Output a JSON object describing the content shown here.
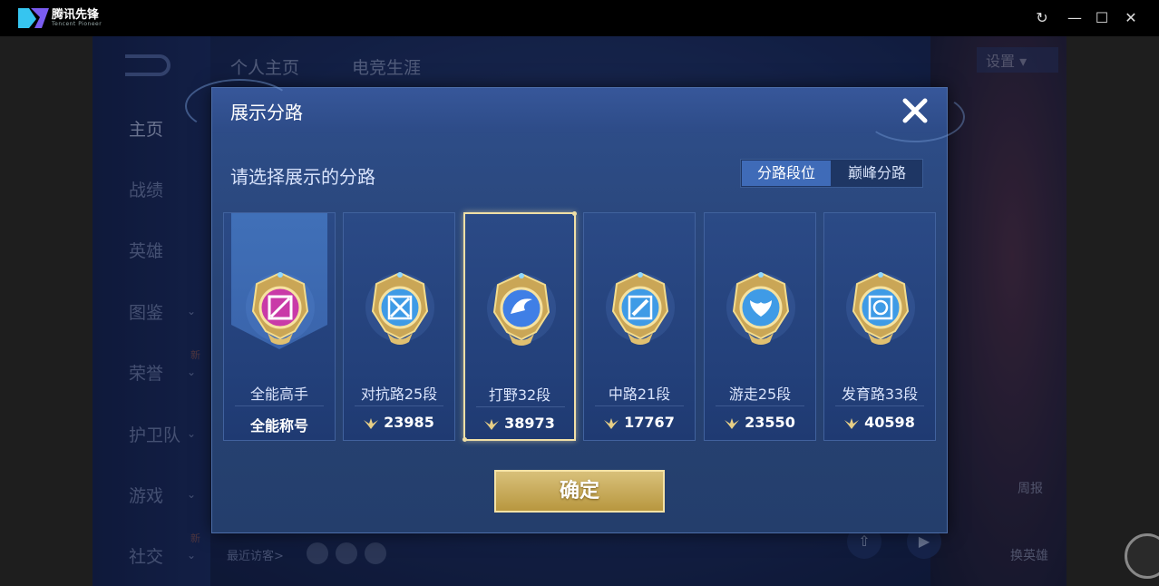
{
  "emulator": {
    "app_name": "腾讯先锋",
    "app_subtitle": "Tencent Pioneer",
    "controls": [
      "↻",
      "—",
      "☐",
      "✕"
    ]
  },
  "background": {
    "top_tabs": [
      "个人主页",
      "电竞生涯"
    ],
    "settings_label": "设置",
    "sidebar_items": [
      {
        "label": "主页",
        "has_chevron": false,
        "badge": ""
      },
      {
        "label": "战绩",
        "has_chevron": false,
        "badge": ""
      },
      {
        "label": "英雄",
        "has_chevron": false,
        "badge": ""
      },
      {
        "label": "图鉴",
        "has_chevron": true,
        "badge": ""
      },
      {
        "label": "荣誉",
        "has_chevron": true,
        "badge": "新"
      },
      {
        "label": "护卫队",
        "has_chevron": true,
        "badge": ""
      },
      {
        "label": "游戏",
        "has_chevron": true,
        "badge": ""
      },
      {
        "label": "社交",
        "has_chevron": true,
        "badge": "新"
      }
    ],
    "recent_visitors_label": "最近访客>",
    "right_buttons": [
      "周报",
      "换英雄"
    ]
  },
  "modal": {
    "title": "展示分路",
    "subtitle": "请选择展示的分路",
    "segments": [
      {
        "label": "分路段位",
        "active": true
      },
      {
        "label": "巅峰分路",
        "active": false
      }
    ],
    "cards": [
      {
        "label": "全能高手",
        "score": "全能称号",
        "has_score_icon": false,
        "selected": false,
        "medal_color": "#c93aa8",
        "icon": "all-round-icon"
      },
      {
        "label": "对抗路25段",
        "score": "23985",
        "has_score_icon": true,
        "selected": false,
        "medal_color": "#3f9be6",
        "icon": "clash-lane-icon"
      },
      {
        "label": "打野32段",
        "score": "38973",
        "has_score_icon": true,
        "selected": true,
        "medal_color": "#3f7fe6",
        "icon": "jungle-icon"
      },
      {
        "label": "中路21段",
        "score": "17767",
        "has_score_icon": true,
        "selected": false,
        "medal_color": "#3f9be6",
        "icon": "mid-lane-icon"
      },
      {
        "label": "游走25段",
        "score": "23550",
        "has_score_icon": true,
        "selected": false,
        "medal_color": "#3f9be6",
        "icon": "roam-icon"
      },
      {
        "label": "发育路33段",
        "score": "40598",
        "has_score_icon": true,
        "selected": false,
        "medal_color": "#3f9be6",
        "icon": "farm-lane-icon"
      }
    ],
    "confirm_label": "确定"
  },
  "colors": {
    "accent_gold": "#f0dfa6",
    "modal_blue": "#2f4f8c",
    "segment_active": "#3f6bb8"
  }
}
